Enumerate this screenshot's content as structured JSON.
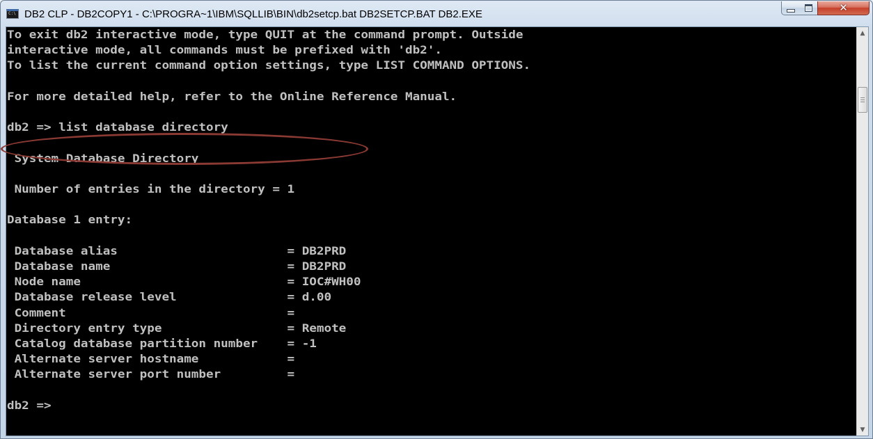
{
  "window": {
    "title": "DB2 CLP - DB2COPY1 - C:\\PROGRA~1\\IBM\\SQLLIB\\BIN\\db2setcp.bat  DB2SETCP.BAT DB2.EXE",
    "icon": "console-window-icon",
    "icon_text": "C:\\",
    "controls": {
      "minimize_icon": "minimize-icon",
      "maximize_icon": "maximize-icon",
      "close_icon": "close-icon"
    }
  },
  "console": {
    "lines": [
      "To exit db2 interactive mode, type QUIT at the command prompt. Outside",
      "interactive mode, all commands must be prefixed with 'db2'.",
      "To list the current command option settings, type LIST COMMAND OPTIONS.",
      "",
      "For more detailed help, refer to the Online Reference Manual.",
      "",
      "db2 => list database directory",
      "",
      " System Database Directory",
      "",
      " Number of entries in the directory = 1",
      "",
      "Database 1 entry:",
      "",
      " Database alias                       = DB2PRD",
      " Database name                        = DB2PRD",
      " Node name                            = IOC#WH00",
      " Database release level               = d.00",
      " Comment                              =",
      " Directory entry type                 = Remote",
      " Catalog database partition number    = -1",
      " Alternate server hostname            =",
      " Alternate server port number         =",
      "",
      "db2 =>"
    ],
    "highlight_color": "#8b3a33"
  },
  "scrollbar": {
    "up_arrow": "▲",
    "down_arrow": "▼"
  },
  "colors": {
    "console_bg": "#000000",
    "console_text": "#c0c0c0",
    "close_button": "#c5402b"
  }
}
